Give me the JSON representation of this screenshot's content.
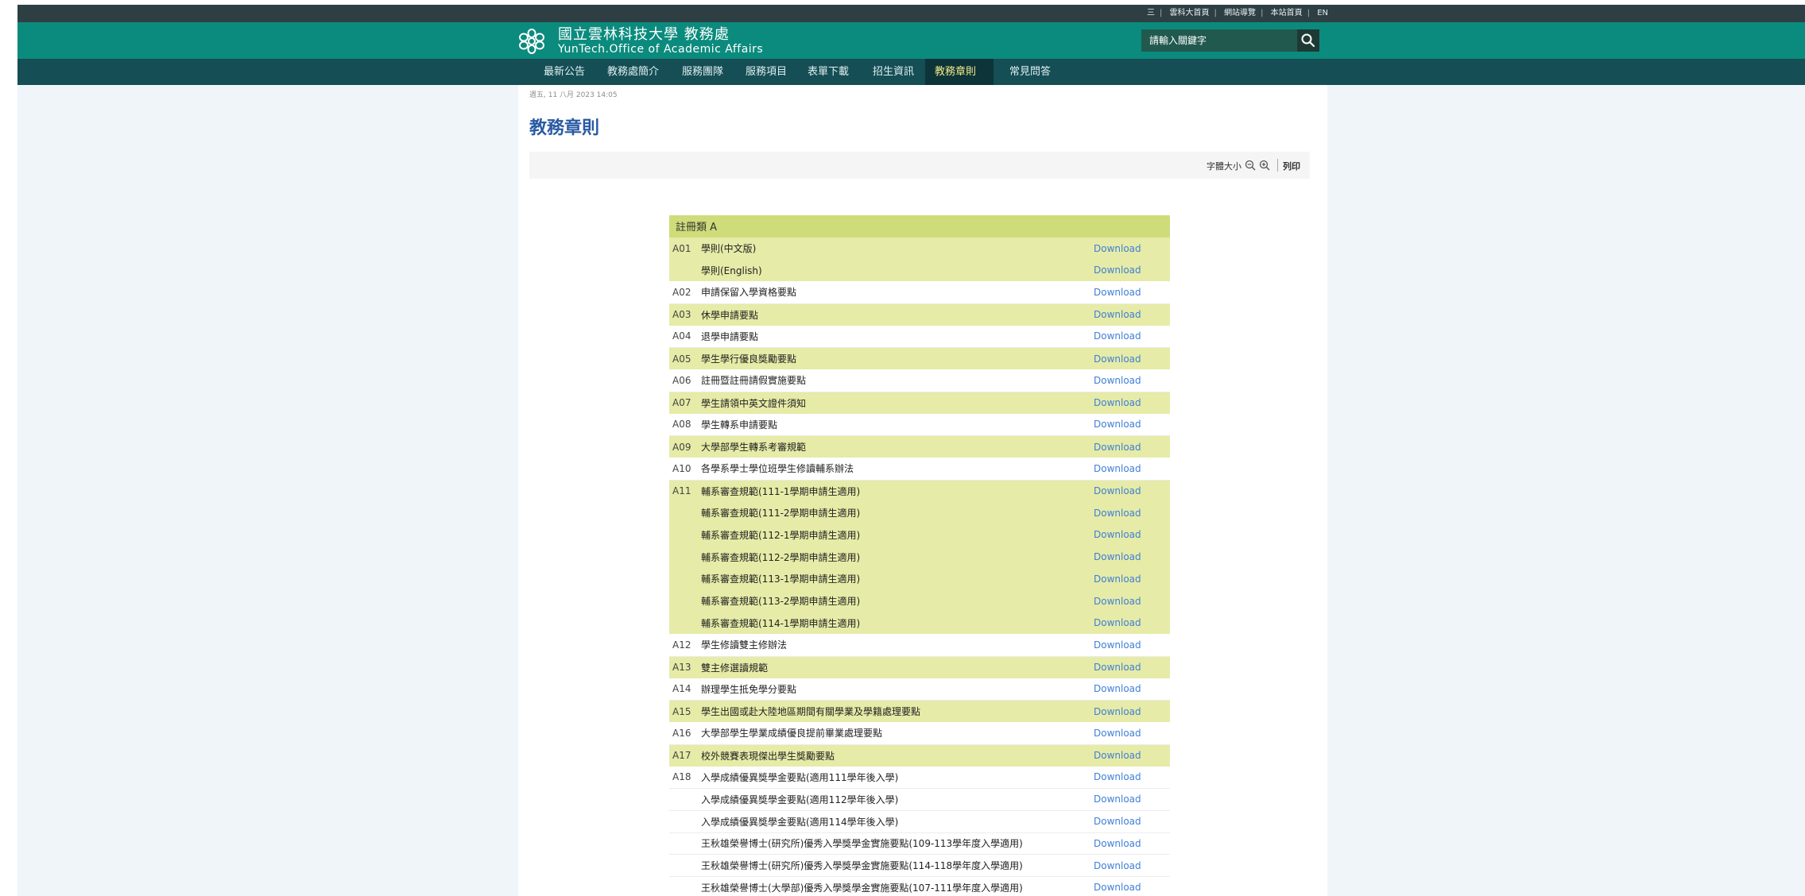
{
  "top_links": [
    "三",
    "雲科大首頁",
    "網站導覽",
    "本站首頁",
    "EN"
  ],
  "header": {
    "title_zh": "國立雲林科技大學 教務處",
    "title_en": "YunTech.Office of Academic Affairs",
    "logo_icon": "yuntech-flower-logo-icon"
  },
  "search": {
    "placeholder": "請輸入關鍵字",
    "icon": "search-icon"
  },
  "nav": {
    "items": [
      {
        "label": "最新公告"
      },
      {
        "label": "教務處簡介"
      },
      {
        "label": "服務團隊"
      },
      {
        "label": "服務項目"
      },
      {
        "label": "表單下載"
      },
      {
        "label": "招生資訊"
      },
      {
        "label": "教務章則"
      },
      {
        "label": "常見問答"
      }
    ],
    "active": "教務章則"
  },
  "page": {
    "date": "週五, 11 八月 2023 14:05",
    "title": "教務章則"
  },
  "toolbar": {
    "font_size_label": "字體大小",
    "print_label": "列印"
  },
  "table": {
    "header": "註冊類 A",
    "download_label": "Download",
    "rows": [
      {
        "code": "A01",
        "title": "學則(中文版)",
        "hl": true
      },
      {
        "code": "",
        "title": "學則(English)",
        "hl": true
      },
      {
        "code": "A02",
        "title": "申請保留入學資格要點",
        "hl": false
      },
      {
        "code": "A03",
        "title": "休學申請要點",
        "hl": true
      },
      {
        "code": "A04",
        "title": "退學申請要點",
        "hl": false
      },
      {
        "code": "A05",
        "title": "學生學行優良獎勵要點",
        "hl": true
      },
      {
        "code": "A06",
        "title": "註冊暨註冊請假實施要點",
        "hl": false
      },
      {
        "code": "A07",
        "title": "學生請領中英文證件須知",
        "hl": true
      },
      {
        "code": "A08",
        "title": "學生轉系申請要點",
        "hl": false
      },
      {
        "code": "A09",
        "title": "大學部學生轉系考審規範",
        "hl": true
      },
      {
        "code": "A10",
        "title": "各學系學士學位班學生修讀輔系辦法",
        "hl": false
      },
      {
        "code": "A11",
        "title": "輔系審查規範(111-1學期申請生適用)",
        "hl": true
      },
      {
        "code": "",
        "title": "輔系審查規範(111-2學期申請生適用)",
        "hl": true
      },
      {
        "code": "",
        "title": "輔系審查規範(112-1學期申請生適用)",
        "hl": true
      },
      {
        "code": "",
        "title": "輔系審查規範(112-2學期申請生適用)",
        "hl": true
      },
      {
        "code": "",
        "title": "輔系審查規範(113-1學期申請生適用)",
        "hl": true
      },
      {
        "code": "",
        "title": "輔系審查規範(113-2學期申請生適用)",
        "hl": true
      },
      {
        "code": "",
        "title": "輔系審查規範(114-1學期申請生適用)",
        "hl": true
      },
      {
        "code": "A12",
        "title": "學生修讀雙主修辦法",
        "hl": false
      },
      {
        "code": "A13",
        "title": "雙主修選讀規範",
        "hl": true
      },
      {
        "code": "A14",
        "title": "辦理學生抵免學分要點",
        "hl": false
      },
      {
        "code": "A15",
        "title": "學生出國或赴大陸地區期間有關學業及學籍處理要點",
        "hl": true
      },
      {
        "code": "A16",
        "title": "大學部學生學業成績優良提前畢業處理要點",
        "hl": false
      },
      {
        "code": "A17",
        "title": "校外競賽表現傑出學生獎勵要點",
        "hl": true
      },
      {
        "code": "A18",
        "title": "入學成績優異獎學金要點(適用111學年後入學)",
        "hl": false
      },
      {
        "code": "",
        "title": "入學成績優異獎學金要點(適用112學年後入學)",
        "hl": false
      },
      {
        "code": "",
        "title": "入學成績優異獎學金要點(適用114學年後入學)",
        "hl": false
      },
      {
        "code": "",
        "title": "王秋雄榮譽博士(研究所)優秀入學獎學金實施要點(109-113學年度入學適用)",
        "hl": false
      },
      {
        "code": "",
        "title": "王秋雄榮譽博士(研究所)優秀入學獎學金實施要點(114-118學年度入學適用)",
        "hl": false
      },
      {
        "code": "",
        "title": "王秋雄榮譽博士(大學部)優秀入學獎學金實施要點(107-111學年度入學適用)",
        "hl": false
      }
    ]
  },
  "colors": {
    "topbar": "#2e3f44",
    "header": "#0b8b7d",
    "navbar": "#154e55",
    "nav_active": "#0d3438",
    "title": "#2a5ba3",
    "table_header": "#cfdc7a",
    "row_highlight": "#e6eba7",
    "download_link": "#3f7fd6"
  }
}
